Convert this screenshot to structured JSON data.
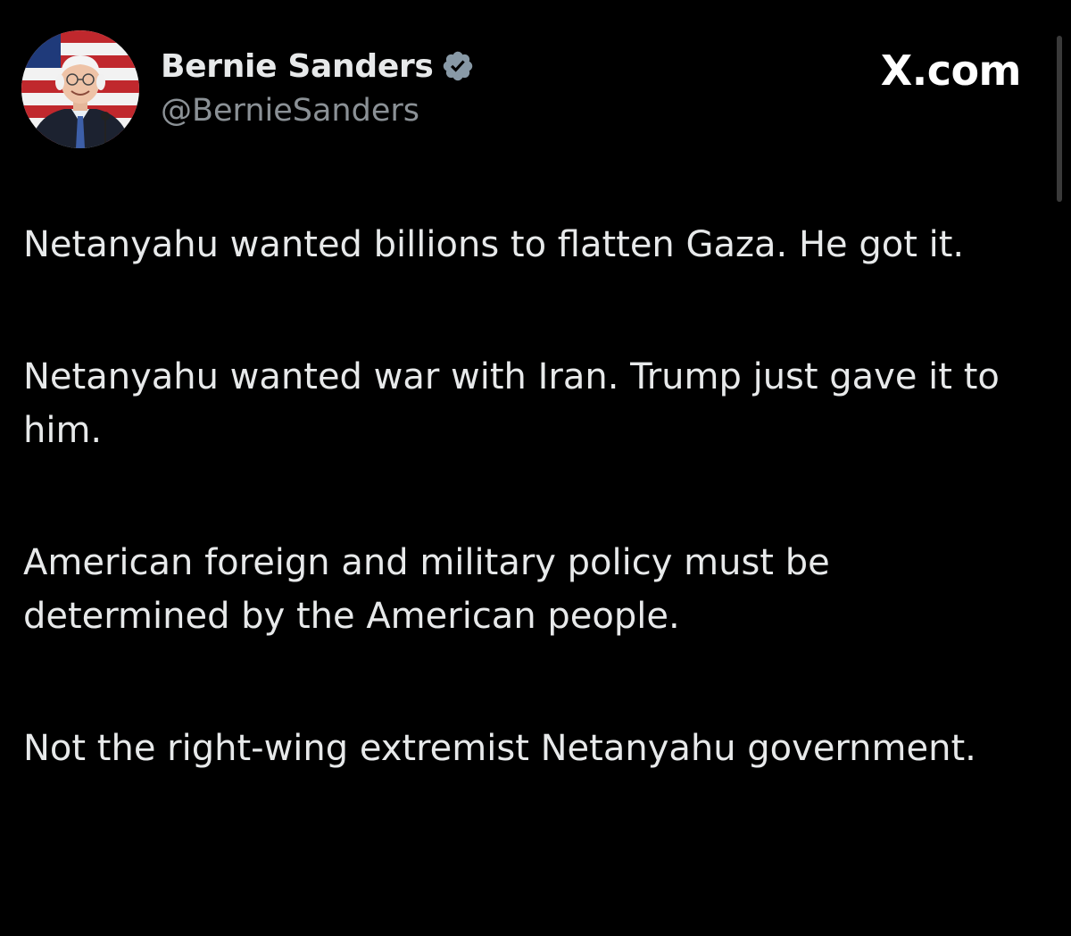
{
  "author": {
    "display_name": "Bernie Sanders",
    "handle": "@BernieSanders",
    "verified": true,
    "avatar_icon": "avatar-photo"
  },
  "brand": {
    "label": "X.com"
  },
  "tweet": {
    "paragraphs": [
      "Netanyahu wanted billions to flatten Gaza. He got it.",
      "Netanyahu wanted war with Iran. Trump just gave it to him.",
      "American foreign and military policy must be determined by the American people.",
      "Not the right-wing extremist Netanyahu government."
    ]
  },
  "colors": {
    "background": "#000000",
    "text_primary": "#e7e9ea",
    "text_secondary": "#8b9196",
    "verified_badge": "#8899a6"
  }
}
